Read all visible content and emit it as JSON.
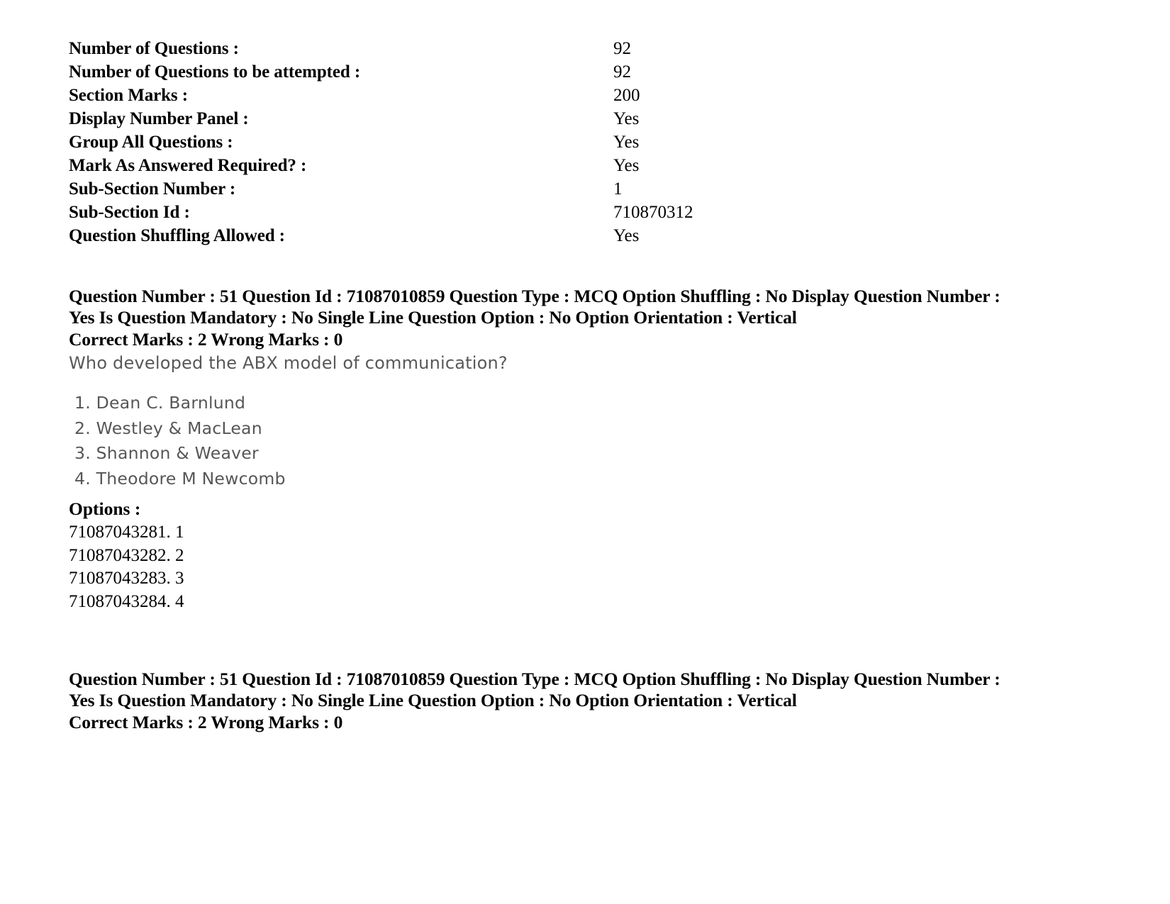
{
  "section_properties": [
    {
      "label": "Number of Questions :",
      "value": "92"
    },
    {
      "label": "Number of Questions to be attempted :",
      "value": "92"
    },
    {
      "label": "Section Marks :",
      "value": "200"
    },
    {
      "label": "Display Number Panel :",
      "value": "Yes"
    },
    {
      "label": "Group All Questions :",
      "value": "Yes"
    },
    {
      "label": "Mark As Answered Required? :",
      "value": "Yes"
    },
    {
      "label": "Sub-Section Number :",
      "value": "1"
    },
    {
      "label": "Sub-Section Id :",
      "value": "710870312"
    },
    {
      "label": "Question Shuffling Allowed :",
      "value": "Yes"
    }
  ],
  "question_block_1": {
    "meta_line_1": "Question Number : 51 Question Id : 71087010859 Question Type : MCQ Option Shuffling : No Display Question Number : Yes Is",
    "meta_line_2": "Question Mandatory : No Single Line Question Option : No Option Orientation : Vertical",
    "marks_line": "Correct Marks : 2 Wrong Marks : 0",
    "scan": {
      "question_text": "Who developed the ABX model of communication?",
      "options": [
        "1. Dean C. Barnlund",
        "2. Westley & MacLean",
        "3. Shannon & Weaver",
        "4. Theodore M Newcomb"
      ]
    },
    "options_heading": "Options :",
    "option_ids": [
      "71087043281. 1",
      "71087043282. 2",
      "71087043283. 3",
      "71087043284. 4"
    ]
  },
  "question_block_2": {
    "meta_line_1": "Question Number : 51 Question Id : 71087010859 Question Type : MCQ Option Shuffling : No Display Question Number : Yes Is",
    "meta_line_2": "Question Mandatory : No Single Line Question Option : No Option Orientation : Vertical",
    "marks_line": "Correct Marks : 2 Wrong Marks : 0"
  }
}
